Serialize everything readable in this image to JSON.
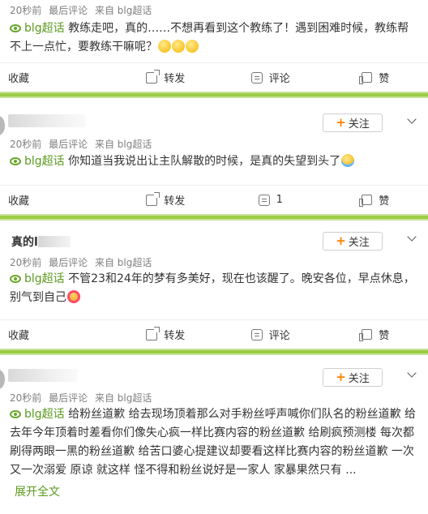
{
  "posts": [
    {
      "meta": {
        "time": "20秒前",
        "last_comment": "最后评论",
        "source": "来自 blg超话"
      },
      "topic": "blg超话",
      "text": "教练走吧，真的……不想再看到这个教练了！遇到困难时候，教练帮不上一点忙，要教练干嘛呢？",
      "emojis": [
        "sweat-face-emoji",
        "sweat-face-emoji",
        "sweat-face-emoji"
      ],
      "actions": {
        "favorite": "收藏",
        "share": "转发",
        "comment": "评论",
        "like": "赞"
      }
    },
    {
      "follow_label": "关注",
      "meta": {
        "time": "20秒前",
        "last_comment": "最后评论",
        "source": "来自 blg超话"
      },
      "topic": "blg超话",
      "text": "你知道当我说出让主队解散的时候，是真的失望到头了",
      "emojis": [
        "crying-face-emoji"
      ],
      "actions": {
        "favorite": "收藏",
        "share": "转发",
        "comment": "1",
        "like": "赞"
      }
    },
    {
      "name_visible": "真的l",
      "follow_label": "关注",
      "meta": {
        "time": "20秒前",
        "last_comment": "最后评论",
        "source": "来自 blg超话"
      },
      "topic": "blg超话",
      "text": "不管23和24年的梦有多美好，现在也该醒了。晚安各位，早点休息，别气到自己",
      "emojis": [
        "love-face-emoji"
      ],
      "actions": {
        "favorite": "收藏",
        "share": "转发",
        "comment": "评论",
        "like": "赞"
      }
    },
    {
      "follow_label": "关注",
      "meta": {
        "time": "20秒前",
        "last_comment": "最后评论",
        "source": "来自 blg超话"
      },
      "topic": "blg超话",
      "text": "给粉丝道歉 给去现场顶着那么对手粉丝呼声喊你们队名的粉丝道歉 给去年今年顶着时差看你们像失心疯一样比赛内容的粉丝道歉 给刷疯预测楼 每次都刷得两眼一黑的粉丝道歉 给苦口婆心提建议却要看这样比赛内容的粉丝道歉 一次又一次溺爱 原谅 就这样 怪不得和粉丝说好是一家人 家暴果然只有 ...",
      "expand_label": "展开全文"
    }
  ],
  "colors": {
    "topic_green": "#5b9a1f",
    "separator_green": "#9ccc45",
    "follow_plus": "#ff8200"
  }
}
